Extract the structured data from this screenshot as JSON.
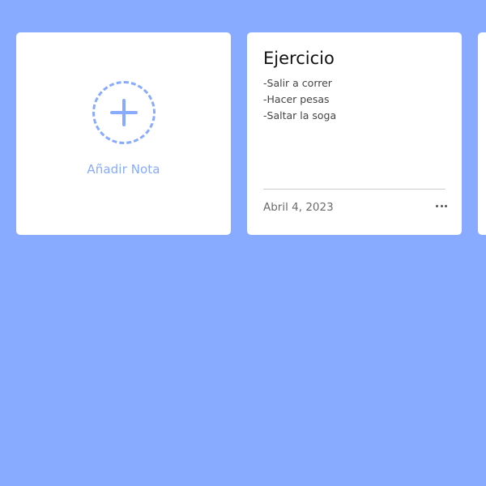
{
  "add_card": {
    "label": "Añadir Nota",
    "icon": "plus-icon",
    "accent_color": "#88aaff"
  },
  "notes": [
    {
      "title": "Ejercicio",
      "lines": [
        "-Salir a correr",
        "-Hacer pesas",
        "-Saltar la soga"
      ],
      "date": "Abril 4, 2023",
      "menu_icon": "more-horizontal-icon"
    }
  ],
  "colors": {
    "background": "#88aaff",
    "card": "#ffffff"
  }
}
